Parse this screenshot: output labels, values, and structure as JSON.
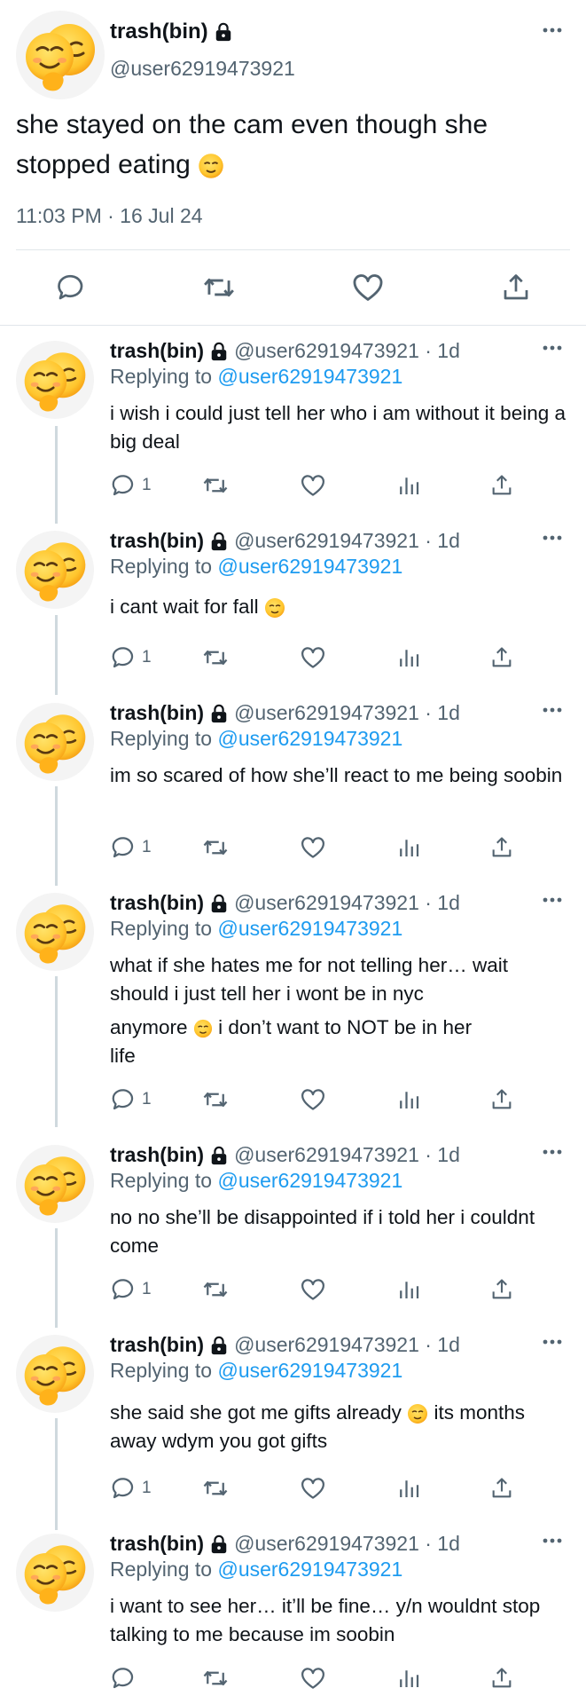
{
  "main_tweet": {
    "display_name": "trash(bin)",
    "handle": "@user62919473921",
    "text": "she stayed on the cam even though she stopped eating",
    "text_emoji": "smiling-face-with-hearts",
    "timestamp": "11:03 PM · 16 Jul 24",
    "actions": [
      "reply-icon",
      "retweet-icon",
      "like-icon",
      "share-icon"
    ]
  },
  "reply_meta": {
    "display_name": "trash(bin)",
    "handle_time": "@user62919473921 · 1d",
    "replying_prefix": "Replying to",
    "replying_mention": "@user62919473921"
  },
  "replies": [
    {
      "text": "i wish i could just tell her who i am without it being a big deal",
      "reply_count": "1"
    },
    {
      "text": "i cant wait for fall",
      "reply_count": "1"
    },
    {
      "text": "im so scared of how she’ll react to me being soobin",
      "reply_count": "1"
    },
    {
      "text_line1": "what if she hates me for not telling her… wait should i just tell her i wont be in nyc",
      "text_line2a": "anymore",
      "text_line2b": "i don’t want to NOT be in her",
      "text_line3": "life",
      "reply_count": "1"
    },
    {
      "text": "no no she’ll be disappointed if i told her i couldnt come",
      "reply_count": "1"
    },
    {
      "text_a": "she said she got me gifts already",
      "text_b": "its months away wdym you got gifts",
      "reply_count": "1"
    },
    {
      "text": "i want to see her… it’ll be fine… y/n wouldnt stop talking to me because im soobin",
      "reply_count": ""
    }
  ],
  "colors": {
    "text": "#0f1419",
    "secondary": "#536471",
    "link": "#1d9bf0",
    "divider": "#e1e6ea",
    "thread_line": "#cfd9de"
  }
}
